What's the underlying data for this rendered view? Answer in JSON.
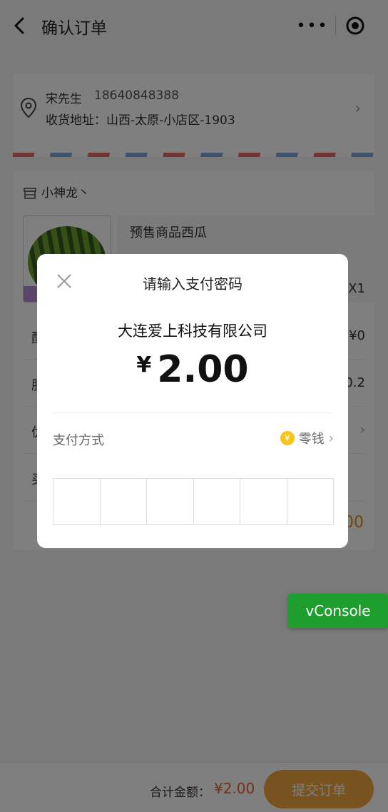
{
  "nav": {
    "title": "确认订单",
    "back_icon": "back-arrow-icon",
    "more_icon": "more-dots-icon",
    "capsule_icon": "target-circle-icon"
  },
  "address": {
    "name": "宋先生",
    "phone": "18640848388",
    "line": "收货地址：山西-太原-小店区-1903"
  },
  "shop": {
    "store_name": "小神龙丶",
    "product_name": "预售商品西瓜",
    "quantity": "X1",
    "rows": [
      {
        "label": "配",
        "value": "¥0"
      },
      {
        "label": "服",
        "value": "0.2"
      },
      {
        "label": "优",
        "value": ""
      },
      {
        "label": "买",
        "value": ""
      }
    ],
    "total_partial": "00"
  },
  "modal": {
    "title": "请输入支付密码",
    "merchant": "大连爱上科技有限公司",
    "currency": "¥",
    "amount": "2.00",
    "pay_method_label": "支付方式",
    "pay_method_value": "零钱",
    "coin_glyph": "¥",
    "password_length": 6
  },
  "bottom": {
    "total_label": "合计金额：",
    "total_value": "¥2.00",
    "submit_label": "提交订单"
  },
  "vconsole": {
    "label": "vConsole"
  },
  "colors": {
    "accent_orange": "#f0a640",
    "price_red": "#e8632b",
    "vconsole_green": "#1e9e2f",
    "coin_yellow": "#f5c518"
  }
}
